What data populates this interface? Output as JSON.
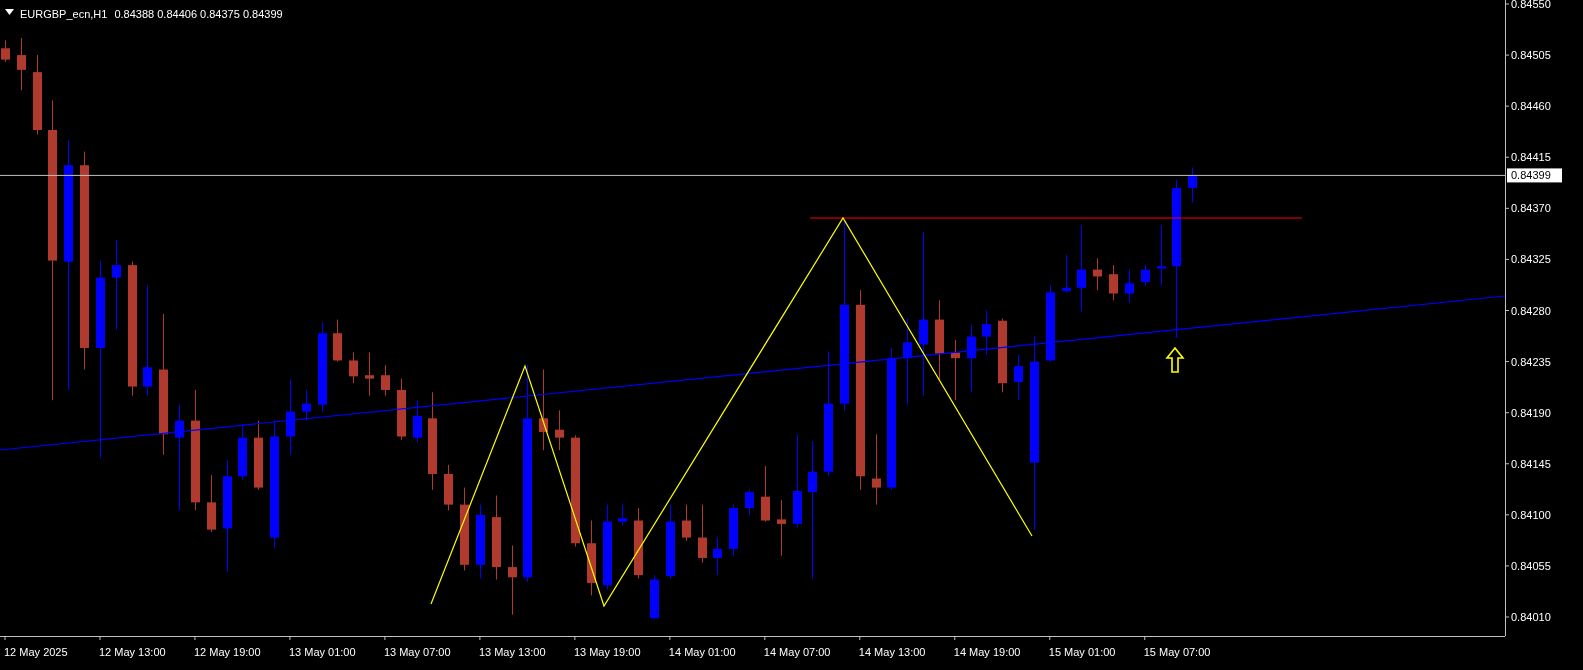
{
  "header": {
    "symbol": "EURGBP_ecn,H1",
    "quote": "0.84388 0.84406 0.84375 0.84399"
  },
  "price_axis": {
    "labels": [
      "0.84550",
      "0.84505",
      "0.84460",
      "0.84415",
      "0.84370",
      "0.84325",
      "0.84280",
      "0.84235",
      "0.84190",
      "0.84145",
      "0.84100",
      "0.84055",
      "0.84010"
    ]
  },
  "current_price_tag": "0.84399",
  "time_axis": {
    "labels": [
      "12 May 2025",
      "12 May 13:00",
      "12 May 19:00",
      "13 May 01:00",
      "13 May 07:00",
      "13 May 13:00",
      "13 May 19:00",
      "14 May 01:00",
      "14 May 07:00",
      "14 May 13:00",
      "14 May 19:00",
      "15 May 01:00",
      "15 May 07:00"
    ]
  }
}
